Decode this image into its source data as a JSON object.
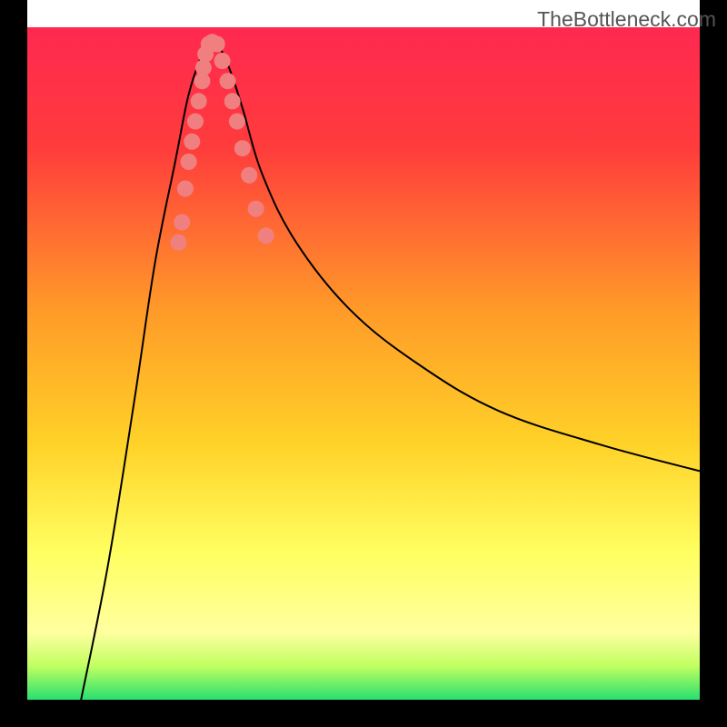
{
  "watermark": "TheBottleneck.com",
  "chart_data": {
    "type": "line",
    "title": "",
    "xlabel": "",
    "ylabel": "",
    "xlim": [
      0,
      100
    ],
    "ylim": [
      0,
      100
    ],
    "background": {
      "type": "vertical-gradient",
      "stops": [
        {
          "offset": 0,
          "color": "#ff2850"
        },
        {
          "offset": 18,
          "color": "#ff3c3c"
        },
        {
          "offset": 42,
          "color": "#ff9a28"
        },
        {
          "offset": 62,
          "color": "#ffd228"
        },
        {
          "offset": 78,
          "color": "#ffff60"
        },
        {
          "offset": 90,
          "color": "#ffffa0"
        },
        {
          "offset": 95,
          "color": "#c0ff60"
        },
        {
          "offset": 100,
          "color": "#28e070"
        }
      ]
    },
    "frame": {
      "margin_left": 30,
      "margin_right": 30,
      "margin_top": 30,
      "margin_bottom": 30,
      "color": "#000000",
      "width_left": 30,
      "width_right": 30,
      "width_bottom": 30
    },
    "curve": {
      "color": "#000000",
      "stroke_width": 2,
      "left_branch_start": {
        "x": 8,
        "y": 0
      },
      "right_branch_end": {
        "x": 100,
        "y": 34
      },
      "minimum": {
        "x": 27,
        "y": 98
      },
      "points": [
        {
          "x": 8,
          "y": 0
        },
        {
          "x": 12,
          "y": 20
        },
        {
          "x": 16,
          "y": 45
        },
        {
          "x": 19,
          "y": 65
        },
        {
          "x": 22,
          "y": 80
        },
        {
          "x": 24,
          "y": 90
        },
        {
          "x": 26,
          "y": 96
        },
        {
          "x": 27,
          "y": 98
        },
        {
          "x": 28,
          "y": 98
        },
        {
          "x": 30,
          "y": 94
        },
        {
          "x": 32,
          "y": 88
        },
        {
          "x": 35,
          "y": 78
        },
        {
          "x": 40,
          "y": 68
        },
        {
          "x": 48,
          "y": 58
        },
        {
          "x": 58,
          "y": 50
        },
        {
          "x": 70,
          "y": 43
        },
        {
          "x": 85,
          "y": 38
        },
        {
          "x": 100,
          "y": 34
        }
      ]
    },
    "markers": {
      "color": "#f08080",
      "radius": 9,
      "points": [
        {
          "x": 22.5,
          "y": 68
        },
        {
          "x": 23.0,
          "y": 71
        },
        {
          "x": 23.5,
          "y": 76
        },
        {
          "x": 24.0,
          "y": 80
        },
        {
          "x": 24.5,
          "y": 83
        },
        {
          "x": 25.0,
          "y": 86
        },
        {
          "x": 25.5,
          "y": 89
        },
        {
          "x": 26.0,
          "y": 92
        },
        {
          "x": 26.2,
          "y": 94
        },
        {
          "x": 26.5,
          "y": 96
        },
        {
          "x": 27.0,
          "y": 97.5
        },
        {
          "x": 27.5,
          "y": 97.8
        },
        {
          "x": 28.2,
          "y": 97.5
        },
        {
          "x": 29.0,
          "y": 95
        },
        {
          "x": 29.8,
          "y": 92
        },
        {
          "x": 30.5,
          "y": 89
        },
        {
          "x": 31.2,
          "y": 86
        },
        {
          "x": 32.0,
          "y": 82
        },
        {
          "x": 33.0,
          "y": 78
        },
        {
          "x": 34.0,
          "y": 73
        },
        {
          "x": 35.5,
          "y": 69
        }
      ]
    }
  }
}
